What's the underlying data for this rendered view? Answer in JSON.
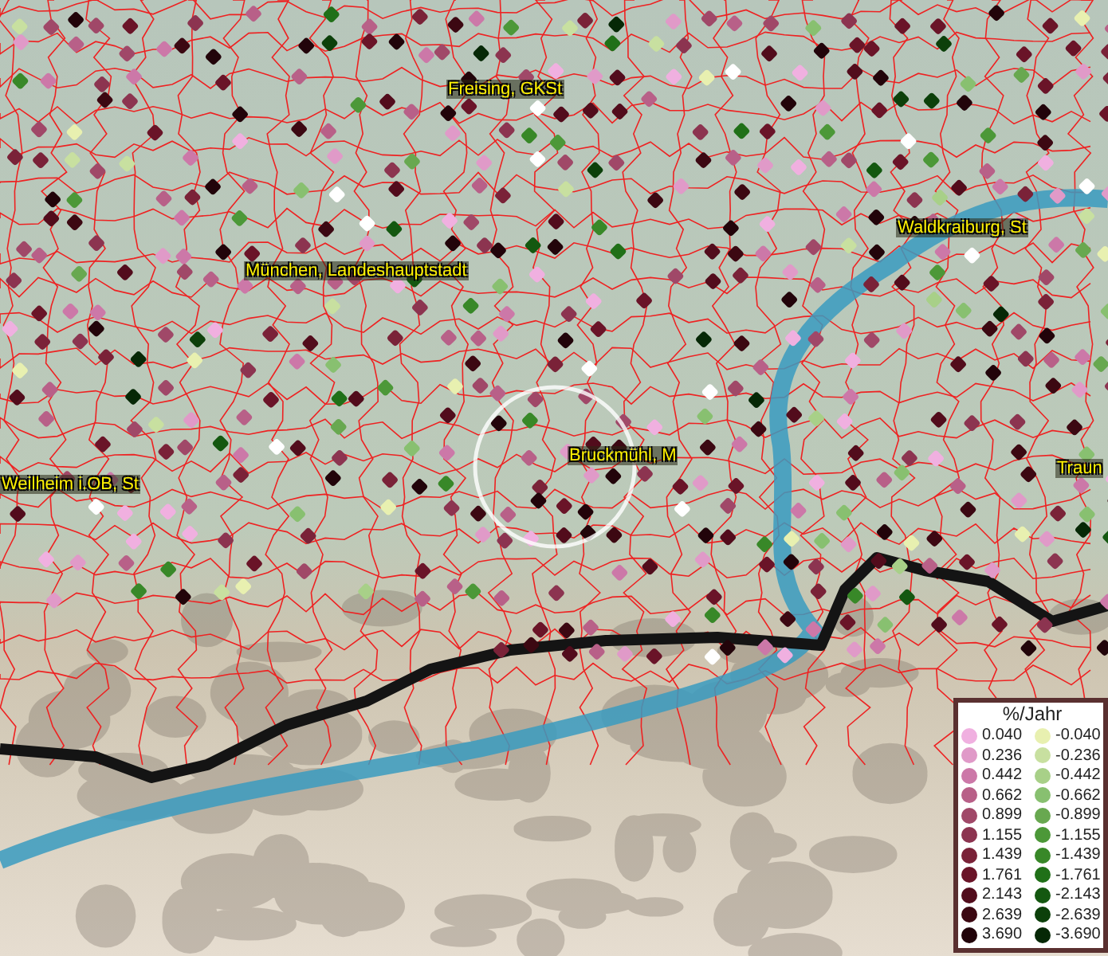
{
  "map": {
    "labels": [
      {
        "text": "Freising, GKSt"
      },
      {
        "text": "München, Landeshauptstadt"
      },
      {
        "text": "Waldkraiburg, St"
      },
      {
        "text": "Bruckmühl, M"
      },
      {
        "text": "Weilheim i.OB, St"
      },
      {
        "text": "Traun"
      }
    ]
  },
  "legend": {
    "title": "%/Jahr",
    "positive": [
      {
        "label": "0.040",
        "color": "#f0b0e0"
      },
      {
        "label": "0.236",
        "color": "#e09ac8"
      },
      {
        "label": "0.442",
        "color": "#cc78a8"
      },
      {
        "label": "0.662",
        "color": "#b86088"
      },
      {
        "label": "0.899",
        "color": "#a04868"
      },
      {
        "label": "1.155",
        "color": "#8c3450"
      },
      {
        "label": "1.439",
        "color": "#7a2238"
      },
      {
        "label": "1.761",
        "color": "#6a1428"
      },
      {
        "label": "2.143",
        "color": "#520c1c"
      },
      {
        "label": "2.639",
        "color": "#3c0812"
      },
      {
        "label": "3.690",
        "color": "#22040a"
      }
    ],
    "negative": [
      {
        "label": "-0.040",
        "color": "#e8f0b0"
      },
      {
        "label": "-0.236",
        "color": "#c8e0a0"
      },
      {
        "label": "-0.442",
        "color": "#a8d088"
      },
      {
        "label": "-0.662",
        "color": "#88c070"
      },
      {
        "label": "-0.899",
        "color": "#68a850"
      },
      {
        "label": "-1.155",
        "color": "#4c9838"
      },
      {
        "label": "-1.439",
        "color": "#388828"
      },
      {
        "label": "-1.761",
        "color": "#207018"
      },
      {
        "label": "-2.143",
        "color": "#145810"
      },
      {
        "label": "-2.639",
        "color": "#0c400a"
      },
      {
        "label": "-3.690",
        "color": "#062806"
      }
    ]
  }
}
